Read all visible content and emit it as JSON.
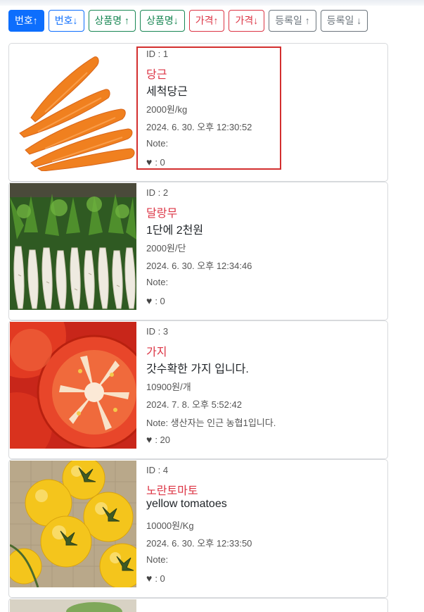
{
  "sort_buttons": [
    {
      "label": "번호↑"
    },
    {
      "label": "번호↓"
    },
    {
      "label": "상품명 ↑"
    },
    {
      "label": "상품명↓"
    },
    {
      "label": "가격↑"
    },
    {
      "label": "가격↓"
    },
    {
      "label": "등록일 ↑"
    },
    {
      "label": "등록일 ↓"
    }
  ],
  "products": [
    {
      "id_label": "ID : 1",
      "name": "당근",
      "description": "세척당근",
      "price": "2000원/kg",
      "date": "2024. 6. 30. 오후 12:30:52",
      "note": "Note:",
      "likes": ": 0",
      "image": "carrots"
    },
    {
      "id_label": "ID : 2",
      "name": "달랑무",
      "description": "1단에 2천원",
      "price": "2000원/단",
      "date": "2024. 6. 30. 오후 12:34:46",
      "note": "Note:",
      "likes": ": 0",
      "image": "radishes"
    },
    {
      "id_label": "ID : 3",
      "name": "가지",
      "description": "갓수확한 가지 입니다.",
      "price": "10900원/개",
      "date": "2024. 7. 8. 오후 5:52:42",
      "note": "Note: 생산자는 인근 농협1입니다.",
      "likes": ": 20",
      "image": "tomato-slices"
    },
    {
      "id_label": "ID : 4",
      "name": "노란토마토",
      "description": "yellow tomatoes",
      "price": "10000원/Kg",
      "date": "2024. 6. 30. 오후 12:33:50",
      "note": "Note:",
      "likes": ": 0",
      "image": "yellow-tomatoes"
    }
  ],
  "heart_icon": "heart-icon",
  "colors": {
    "active": "#0d6efd",
    "primary": "#0d6efd",
    "success": "#198754",
    "danger": "#dc3545",
    "secondary": "#6c757d",
    "highlight": "#d32f2f"
  }
}
